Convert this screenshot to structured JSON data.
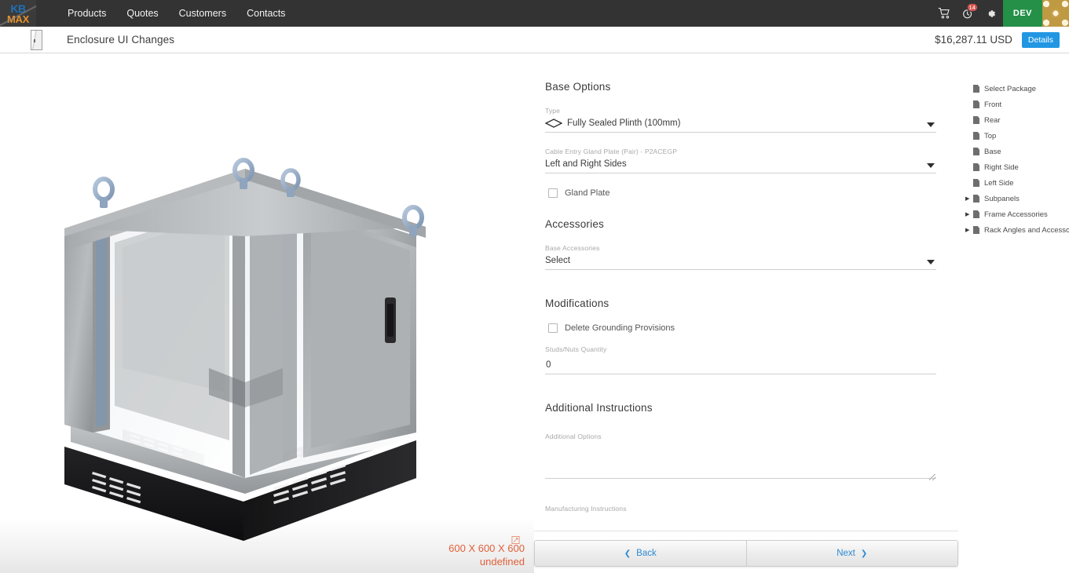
{
  "topnav": {
    "logo": {
      "line1": "KB",
      "line2": "MAX",
      "name": "kbmax-logo"
    },
    "links": [
      "Products",
      "Quotes",
      "Customers",
      "Contacts"
    ],
    "cart_icon": "cart-icon",
    "notifications_icon": "notifications-icon",
    "notifications_badge": "14",
    "settings_icon": "gear-icon",
    "environment_badge": "DEV",
    "avatar": "user-avatar"
  },
  "subheader": {
    "thumbnail": "enclosure-thumbnail",
    "title": "Enclosure UI Changes",
    "price": "$16,287.11 USD",
    "details_label": "Details"
  },
  "viewer": {
    "dimensions": "600 X 600 X 600",
    "dimension_note": "undefined",
    "expand_icon": "expand-icon",
    "model": "enclosure-3d-model"
  },
  "form": {
    "sections": [
      {
        "title": "Base Options"
      },
      {
        "title": "Accessories"
      },
      {
        "title": "Modifications"
      },
      {
        "title": "Additional Instructions"
      }
    ],
    "type_field": {
      "label": "Type",
      "value": "Fully Sealed Plinth (100mm)",
      "icon": "diamond-icon"
    },
    "gland_plate_pair_field": {
      "label": "Cable Entry Gland Plate (Pair) - P2ACEGP",
      "value": "Left and Right Sides"
    },
    "gland_plate_checkbox": {
      "label": "Gland Plate",
      "checked": false
    },
    "base_accessories_field": {
      "label": "Base Accessories",
      "value": "Select"
    },
    "delete_grounding_checkbox": {
      "label": "Delete Grounding Provisions",
      "checked": false
    },
    "studs_nuts_field": {
      "label": "Studs/Nuts Quantity",
      "value": "0"
    },
    "additional_options_field": {
      "label": "Additional Options",
      "value": "",
      "placeholder": ""
    },
    "manufacturing_instructions_field": {
      "label": "Manufacturing Instructions",
      "value": "",
      "placeholder": ""
    }
  },
  "tree": {
    "items": [
      {
        "label": "Select Package",
        "expandable": false
      },
      {
        "label": "Front",
        "expandable": false
      },
      {
        "label": "Rear",
        "expandable": false
      },
      {
        "label": "Top",
        "expandable": false
      },
      {
        "label": "Base",
        "expandable": false
      },
      {
        "label": "Right Side",
        "expandable": false
      },
      {
        "label": "Left Side",
        "expandable": false
      },
      {
        "label": "Subpanels",
        "expandable": true
      },
      {
        "label": "Frame Accessories",
        "expandable": true
      },
      {
        "label": "Rack Angles and Accessories",
        "expandable": true
      }
    ],
    "arrow_glyph": "▶"
  },
  "footer": {
    "back_label": "Back",
    "next_label": "Next",
    "back_chevron": "❮",
    "next_chevron": "❯"
  },
  "colors": {
    "topnav_bg": "#333333",
    "accent_blue": "#2196e3",
    "dev_green": "#249048",
    "badge_red": "#d9534f",
    "dimension_orange": "#e0603a"
  }
}
